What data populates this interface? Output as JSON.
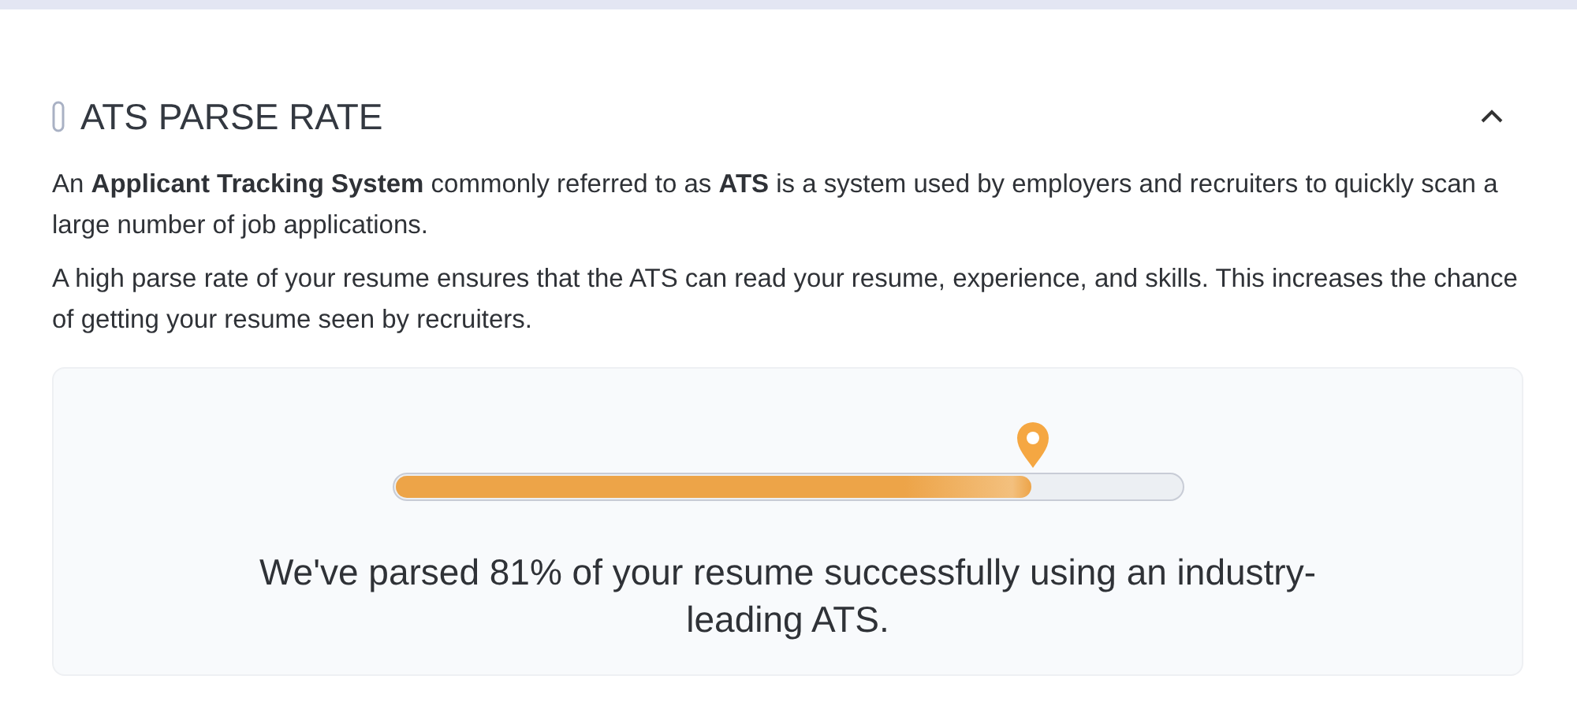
{
  "section": {
    "title": "ATS PARSE RATE",
    "expanded": true,
    "paragraphs": [
      "An **Applicant Tracking System** commonly referred to as **ATS** is a system used by employers and recruiters to quickly scan a large number of job applications.",
      "A high parse rate of your resume ensures that the ATS can read your resume, experience, and skills. This increases the chance of getting your resume seen by recruiters."
    ],
    "parse": {
      "level": 0.81,
      "message": "We've parsed 81% of your resume successfully using an industry-leading ATS."
    }
  }
}
